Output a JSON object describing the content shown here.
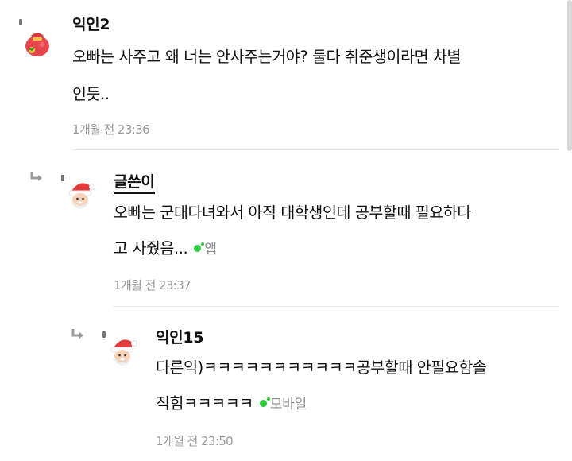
{
  "comments": [
    {
      "author": "익인2",
      "lines": [
        "오빠는 사주고 왜 너는 안사주는거야? 둘다 취준생이라면 차별",
        "인듯.."
      ],
      "timestamp": "1개월 전 23:36",
      "avatar": "red-pouch-icon"
    },
    {
      "author": "글쓴이",
      "lines": [
        "오빠는 군대다녀와서 아직 대학생인데 공부할때 필요하다",
        "고 사줬음..."
      ],
      "device": "앱",
      "timestamp": "1개월 전 23:37",
      "avatar": "santa-icon"
    },
    {
      "author": "익인15",
      "lines": [
        "다른익)ㅋㅋㅋㅋㅋㅋㅋㅋㅋㅋㅋ공부할때 안필요함솔",
        "직힘ㅋㅋㅋㅋㅋ"
      ],
      "device": "모바일",
      "timestamp": "1개월 전 23:50",
      "avatar": "santa-icon"
    }
  ],
  "colors": {
    "online_dot": "#2ecc40",
    "meta_text": "#9a9a9a",
    "divider": "#e6e6e6"
  }
}
